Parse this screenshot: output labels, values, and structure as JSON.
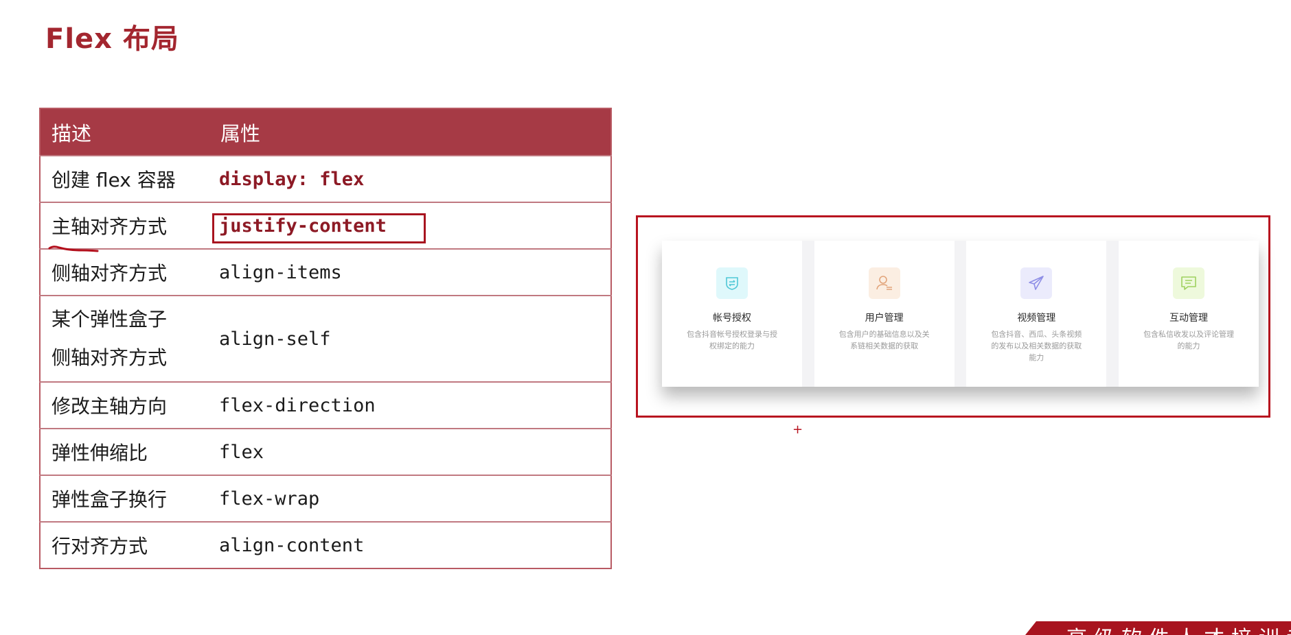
{
  "title": "Flex 布局",
  "table": {
    "headers": [
      "描述",
      "属性"
    ],
    "rows": [
      {
        "desc": "创建 flex 容器",
        "prop": "display: flex"
      },
      {
        "desc": "主轴对齐方式",
        "prop": "justify-content"
      },
      {
        "desc": "侧轴对齐方式",
        "prop": "align-items"
      },
      {
        "desc_line1": "某个弹性盒子",
        "desc_line2": "侧轴对齐方式",
        "prop": "align-self"
      },
      {
        "desc": "修改主轴方向",
        "prop": "flex-direction"
      },
      {
        "desc": "弹性伸缩比",
        "prop": "flex"
      },
      {
        "desc": "弹性盒子换行",
        "prop": "flex-wrap"
      },
      {
        "desc": "行对齐方式",
        "prop": "align-content"
      }
    ]
  },
  "demo": {
    "cards": [
      {
        "icon": "shield-icon",
        "icon_bg": "#dff8fb",
        "icon_color": "#4fc7d6",
        "title": "帐号授权",
        "desc": "包含抖音帐号授权登录与授权绑定的能力"
      },
      {
        "icon": "user-icon",
        "icon_bg": "#fbeee2",
        "icon_color": "#e2a47a",
        "title": "用户管理",
        "desc": "包含用户的基础信息以及关系链相关数据的获取"
      },
      {
        "icon": "send-icon",
        "icon_bg": "#ebebfc",
        "icon_color": "#8e8ee6",
        "title": "视频管理",
        "desc": "包含抖音、西瓜、头条视频的发布以及相关数据的获取能力"
      },
      {
        "icon": "message-icon",
        "icon_bg": "#eef9dc",
        "icon_color": "#9ed15f",
        "title": "互动管理",
        "desc": "包含私信收发以及评论管理的能力"
      }
    ],
    "plus": "+"
  },
  "footer": {
    "text": "高级软件人才培训专家"
  },
  "colors": {
    "brand": "#a3262f",
    "header_bg": "#a63a45",
    "highlight": "#a8141f"
  }
}
